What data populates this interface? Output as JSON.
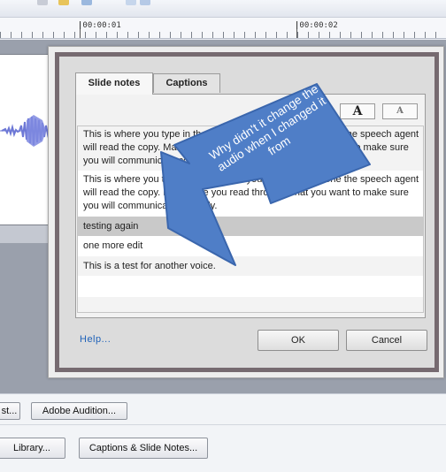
{
  "ruler": {
    "label_1": "|00:00:01",
    "label_2": "|00:00:02"
  },
  "dialog": {
    "tabs": [
      {
        "label": "Slide notes",
        "active": true
      },
      {
        "label": "Captions",
        "active": false
      }
    ],
    "format_buttons": [
      "A",
      "A"
    ],
    "notes": [
      {
        "lines": [
          "This is where you type in the copy for your slide. Once done the speech agent",
          "will read the copy. Make sure you read through what you want to make sure",
          "you will communicate correctly."
        ]
      },
      {
        "lines": [
          "This is where you type in the copy for your slide. Once done the speech agent",
          "will read the copy. Make sure you read through what you want to make sure",
          "you will communicate correctly."
        ]
      },
      {
        "lines": [
          "testing again"
        ],
        "selected": true
      },
      {
        "lines": [
          "one more edit"
        ]
      },
      {
        "lines": [
          "This is a test for another voice."
        ]
      }
    ],
    "help_label": "Help...",
    "ok_label": "OK",
    "cancel_label": "Cancel"
  },
  "annotation": {
    "text": "Why didn't it change the audio when I changed it from",
    "color": "#4f7ec7"
  },
  "bottom_bar": {
    "row1": [
      "st...",
      "Adobe Audition..."
    ],
    "row2": [
      "Library...",
      "Captions & Slide Notes..."
    ]
  },
  "colors": {
    "dialog_frame": "#766a70",
    "link": "#1f62b9",
    "timeline_bg": "#9aa0ac"
  }
}
